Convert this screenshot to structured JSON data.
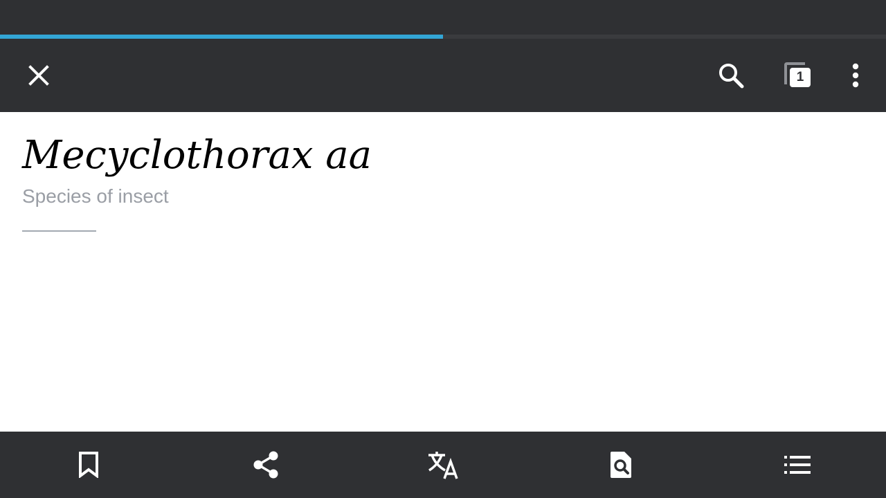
{
  "loading_progress_percent": 50,
  "colors": {
    "bar_background": "#2f3033",
    "progress_accent": "#33a6d6",
    "title_text": "#000000",
    "subtitle_text": "#9a9ea5",
    "divider": "#a2a9b1",
    "icon": "#ffffff"
  },
  "toolbar": {
    "close_icon": "close-icon",
    "search_icon": "search-icon",
    "tabs_icon": "tabs-icon",
    "tab_count": "1",
    "overflow_icon": "more-vert-icon"
  },
  "article": {
    "title": "Mecyclothorax aa",
    "description": "Species of insect"
  },
  "bottom_bar": {
    "items": [
      {
        "icon": "bookmark-icon"
      },
      {
        "icon": "share-icon"
      },
      {
        "icon": "translate-icon"
      },
      {
        "icon": "find-in-page-icon"
      },
      {
        "icon": "contents-list-icon"
      }
    ]
  }
}
